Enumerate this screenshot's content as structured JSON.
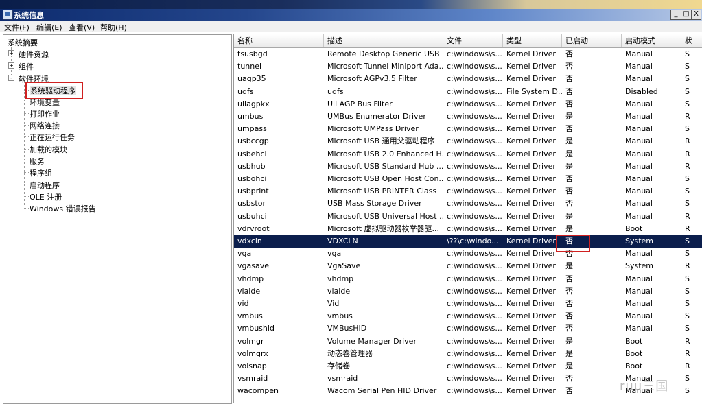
{
  "window": {
    "title": "系统信息",
    "buttons": {
      "minimize": "_",
      "maximize": "□",
      "close": "X"
    }
  },
  "menu": [
    "文件(F)",
    "编辑(E)",
    "查看(V)",
    "帮助(H)"
  ],
  "tree": {
    "root": "系统摘要",
    "nodes": [
      {
        "label": "硬件资源",
        "expander": "+"
      },
      {
        "label": "组件",
        "expander": "+"
      },
      {
        "label": "软件环境",
        "expander": "-"
      }
    ],
    "children": [
      "系统驱动程序",
      "环境变量",
      "打印作业",
      "网络连接",
      "正在运行任务",
      "加载的模块",
      "服务",
      "程序组",
      "启动程序",
      "OLE 注册",
      "Windows 错误报告"
    ]
  },
  "table": {
    "columns": [
      "名称",
      "描述",
      "文件",
      "类型",
      "已启动",
      "启动模式",
      "状"
    ],
    "rows": [
      [
        "tsusbgd",
        "Remote Desktop Generic USB ...",
        "c:\\windows\\s...",
        "Kernel Driver",
        "否",
        "Manual",
        "S"
      ],
      [
        "tunnel",
        "Microsoft Tunnel Miniport Ada...",
        "c:\\windows\\s...",
        "Kernel Driver",
        "否",
        "Manual",
        "S"
      ],
      [
        "uagp35",
        "Microsoft AGPv3.5 Filter",
        "c:\\windows\\s...",
        "Kernel Driver",
        "否",
        "Manual",
        "S"
      ],
      [
        "udfs",
        "udfs",
        "c:\\windows\\s...",
        "File System D...",
        "否",
        "Disabled",
        "S"
      ],
      [
        "uliagpkx",
        "Uli AGP Bus Filter",
        "c:\\windows\\s...",
        "Kernel Driver",
        "否",
        "Manual",
        "S"
      ],
      [
        "umbus",
        "UMBus Enumerator Driver",
        "c:\\windows\\s...",
        "Kernel Driver",
        "是",
        "Manual",
        "R"
      ],
      [
        "umpass",
        "Microsoft UMPass Driver",
        "c:\\windows\\s...",
        "Kernel Driver",
        "否",
        "Manual",
        "S"
      ],
      [
        "usbccgp",
        "Microsoft USB 通用父驱动程序",
        "c:\\windows\\s...",
        "Kernel Driver",
        "是",
        "Manual",
        "R"
      ],
      [
        "usbehci",
        "Microsoft USB 2.0 Enhanced H...",
        "c:\\windows\\s...",
        "Kernel Driver",
        "是",
        "Manual",
        "R"
      ],
      [
        "usbhub",
        "Microsoft USB Standard Hub ...",
        "c:\\windows\\s...",
        "Kernel Driver",
        "是",
        "Manual",
        "R"
      ],
      [
        "usbohci",
        "Microsoft USB Open Host Con...",
        "c:\\windows\\s...",
        "Kernel Driver",
        "否",
        "Manual",
        "S"
      ],
      [
        "usbprint",
        "Microsoft USB PRINTER Class",
        "c:\\windows\\s...",
        "Kernel Driver",
        "否",
        "Manual",
        "S"
      ],
      [
        "usbstor",
        "USB Mass Storage Driver",
        "c:\\windows\\s...",
        "Kernel Driver",
        "否",
        "Manual",
        "S"
      ],
      [
        "usbuhci",
        "Microsoft USB Universal Host ...",
        "c:\\windows\\s...",
        "Kernel Driver",
        "是",
        "Manual",
        "R"
      ],
      [
        "vdrvroot",
        "Microsoft 虚拟驱动器枚举器驱...",
        "c:\\windows\\s...",
        "Kernel Driver",
        "是",
        "Boot",
        "R"
      ],
      [
        "vdxcln",
        "VDXCLN",
        "\\??\\c:\\windo...",
        "Kernel Driver",
        "否",
        "System",
        "S"
      ],
      [
        "vga",
        "vga",
        "c:\\windows\\s...",
        "Kernel Driver",
        "否",
        "Manual",
        "S"
      ],
      [
        "vgasave",
        "VgaSave",
        "c:\\windows\\s...",
        "Kernel Driver",
        "是",
        "System",
        "R"
      ],
      [
        "vhdmp",
        "vhdmp",
        "c:\\windows\\s...",
        "Kernel Driver",
        "否",
        "Manual",
        "S"
      ],
      [
        "viaide",
        "viaide",
        "c:\\windows\\s...",
        "Kernel Driver",
        "否",
        "Manual",
        "S"
      ],
      [
        "vid",
        "Vid",
        "c:\\windows\\s...",
        "Kernel Driver",
        "否",
        "Manual",
        "S"
      ],
      [
        "vmbus",
        "vmbus",
        "c:\\windows\\s...",
        "Kernel Driver",
        "否",
        "Manual",
        "S"
      ],
      [
        "vmbushid",
        "VMBusHID",
        "c:\\windows\\s...",
        "Kernel Driver",
        "否",
        "Manual",
        "S"
      ],
      [
        "volmgr",
        "Volume Manager Driver",
        "c:\\windows\\s...",
        "Kernel Driver",
        "是",
        "Boot",
        "R"
      ],
      [
        "volmgrx",
        "动态卷管理器",
        "c:\\windows\\s...",
        "Kernel Driver",
        "是",
        "Boot",
        "R"
      ],
      [
        "volsnap",
        "存储卷",
        "c:\\windows\\s...",
        "Kernel Driver",
        "是",
        "Boot",
        "R"
      ],
      [
        "vsmraid",
        "vsmraid",
        "c:\\windows\\s...",
        "Kernel Driver",
        "否",
        "Manual",
        "S"
      ],
      [
        "wacompen",
        "Wacom Serial Pen HID Driver",
        "c:\\windows\\s...",
        "Kernel Driver",
        "否",
        "Manual",
        "S"
      ]
    ],
    "selected_row": 15
  },
  "watermark": "ruu三国",
  "colors": {
    "selection": "#0b1e4c",
    "highlight_box": "#d02020"
  }
}
